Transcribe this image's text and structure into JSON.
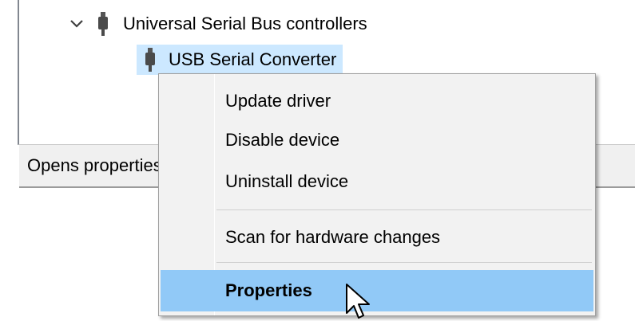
{
  "tree": {
    "category_label": "Universal Serial Bus controllers",
    "selected_device_label": "USB Serial Converter"
  },
  "status_bar": {
    "text": "Opens properties dialog for the current selection."
  },
  "context_menu": {
    "items": [
      {
        "label": "Update driver"
      },
      {
        "label": "Disable device"
      },
      {
        "label": "Uninstall device"
      },
      {
        "label": "Scan for hardware changes"
      },
      {
        "label": "Properties"
      }
    ],
    "highlighted_item": "Properties"
  },
  "icons": {
    "expand": "chevron-down-icon",
    "usb": "usb-plug-icon",
    "cursor": "mouse-pointer-icon"
  },
  "colors": {
    "selection": "#cce8ff",
    "menu_highlight": "#91c9f7",
    "menu_background": "#f2f2f2"
  }
}
